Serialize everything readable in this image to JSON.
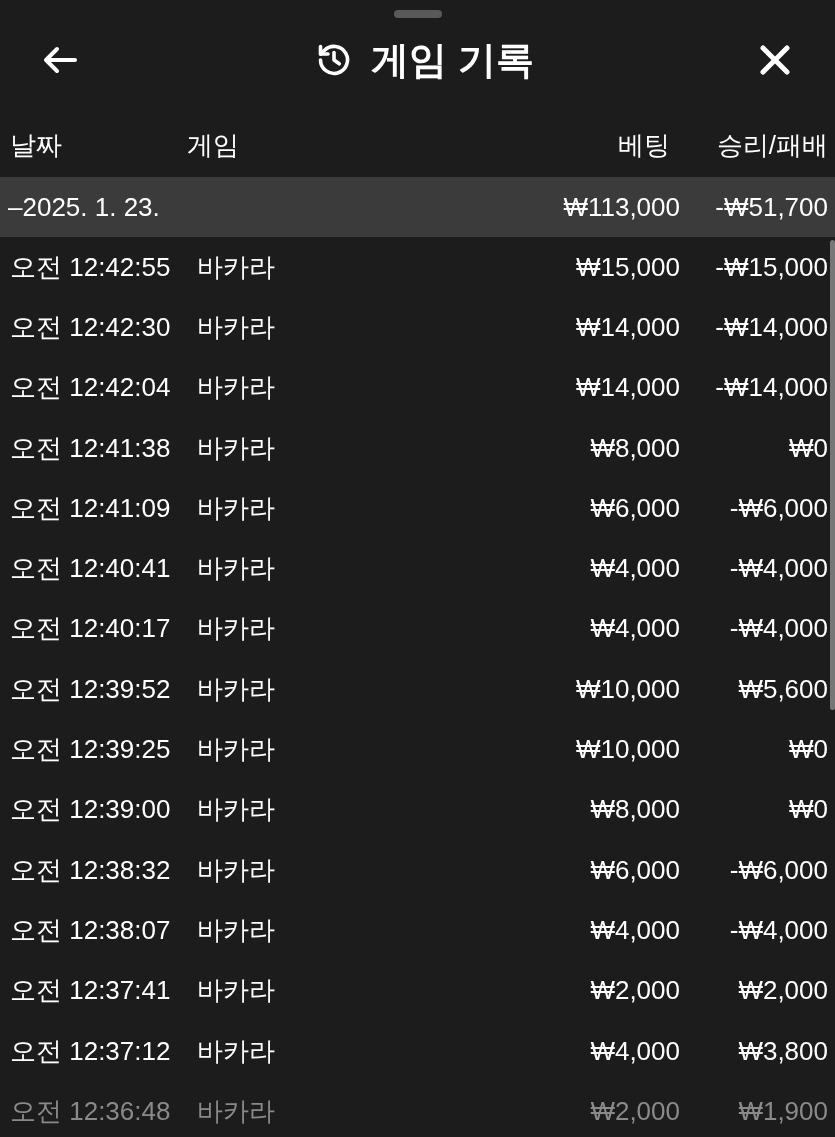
{
  "header": {
    "title": "게임 기록"
  },
  "columns": [
    "날짜",
    "게임",
    "베팅",
    "승리/패배"
  ],
  "group": {
    "date": "–2025. 1. 23.",
    "bet": "₩113,000",
    "result": "-₩51,700"
  },
  "rows": [
    {
      "time": "오전 12:42:55",
      "game": "바카라",
      "bet": "₩15,000",
      "result": "-₩15,000"
    },
    {
      "time": "오전 12:42:30",
      "game": "바카라",
      "bet": "₩14,000",
      "result": "-₩14,000"
    },
    {
      "time": "오전 12:42:04",
      "game": "바카라",
      "bet": "₩14,000",
      "result": "-₩14,000"
    },
    {
      "time": "오전 12:41:38",
      "game": "바카라",
      "bet": "₩8,000",
      "result": "₩0"
    },
    {
      "time": "오전 12:41:09",
      "game": "바카라",
      "bet": "₩6,000",
      "result": "-₩6,000"
    },
    {
      "time": "오전 12:40:41",
      "game": "바카라",
      "bet": "₩4,000",
      "result": "-₩4,000"
    },
    {
      "time": "오전 12:40:17",
      "game": "바카라",
      "bet": "₩4,000",
      "result": "-₩4,000"
    },
    {
      "time": "오전 12:39:52",
      "game": "바카라",
      "bet": "₩10,000",
      "result": "₩5,600"
    },
    {
      "time": "오전 12:39:25",
      "game": "바카라",
      "bet": "₩10,000",
      "result": "₩0"
    },
    {
      "time": "오전 12:39:00",
      "game": "바카라",
      "bet": "₩8,000",
      "result": "₩0"
    },
    {
      "time": "오전 12:38:32",
      "game": "바카라",
      "bet": "₩6,000",
      "result": "-₩6,000"
    },
    {
      "time": "오전 12:38:07",
      "game": "바카라",
      "bet": "₩4,000",
      "result": "-₩4,000"
    },
    {
      "time": "오전 12:37:41",
      "game": "바카라",
      "bet": "₩2,000",
      "result": "₩2,000"
    },
    {
      "time": "오전 12:37:12",
      "game": "바카라",
      "bet": "₩4,000",
      "result": "₩3,800"
    },
    {
      "time": "오전 12:36:48",
      "game": "바카라",
      "bet": "₩2,000",
      "result": "₩1,900"
    }
  ]
}
